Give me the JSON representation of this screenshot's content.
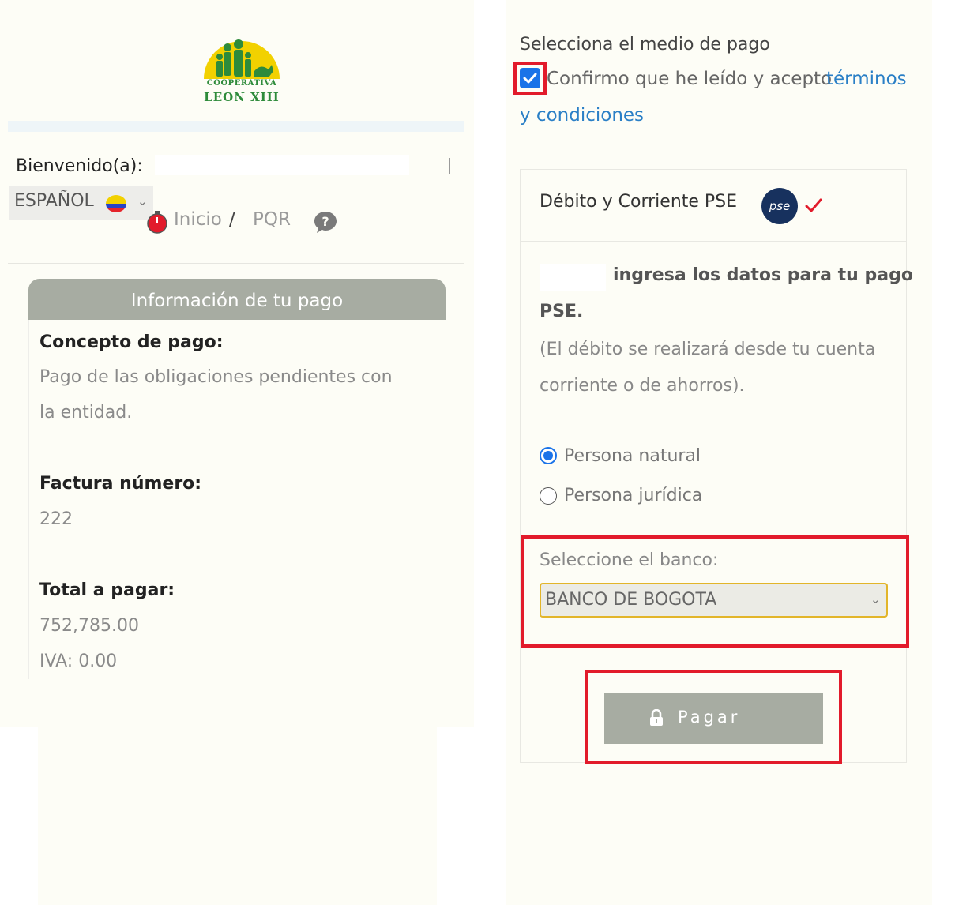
{
  "header": {
    "logo_line1": "COOPERATIVA",
    "logo_line2": "LEON XIII",
    "welcome": "Bienvenido(a):",
    "language": "ESPAÑOL",
    "nav": {
      "home": "Inicio",
      "separator": "/",
      "pqr": "PQR"
    }
  },
  "payment_info": {
    "header": "Información de tu pago",
    "concept_label": "Concepto de pago:",
    "concept_value_line1": "Pago de las obligaciones pendientes con",
    "concept_value_line2": "la entidad.",
    "invoice_label": "Factura número:",
    "invoice_value": "222",
    "total_label": "Total a pagar:",
    "total_value": "752,785.00",
    "iva": "IVA: 0.00"
  },
  "payment_method": {
    "title": "Selecciona el medio de pago",
    "terms_prefix": "Confirmo que he leído y acepto",
    "terms_link_1": "términos",
    "terms_link_2": "y condiciones",
    "terms_checked": true,
    "card_title": "Débito y Corriente PSE",
    "pse_logo_text": "pse",
    "intro_line1": "ingresa los datos para tu pago",
    "intro_line2": "PSE.",
    "debit_note": "(El débito se realizará desde tu cuenta corriente o de ahorros).",
    "person_types": [
      "Persona natural",
      "Persona jurídica"
    ],
    "person_selected": "Persona natural",
    "bank_label": "Seleccione el banco:",
    "bank_selected": "BANCO DE BOGOTA",
    "pay_button": "Pagar"
  },
  "colors": {
    "accent_blue": "#1a73e8",
    "link_blue": "#2a7fc6",
    "highlight_red": "#e21b2b",
    "header_gray": "#a7aca2",
    "select_border": "#e2b52a",
    "logo_green": "#2e8b3b",
    "logo_yellow": "#f2d100"
  },
  "icons": [
    "home-icon",
    "help-icon",
    "pse-logo-icon",
    "check-mark-icon",
    "lock-icon",
    "chevron-down-icon",
    "colombia-flag-icon"
  ]
}
